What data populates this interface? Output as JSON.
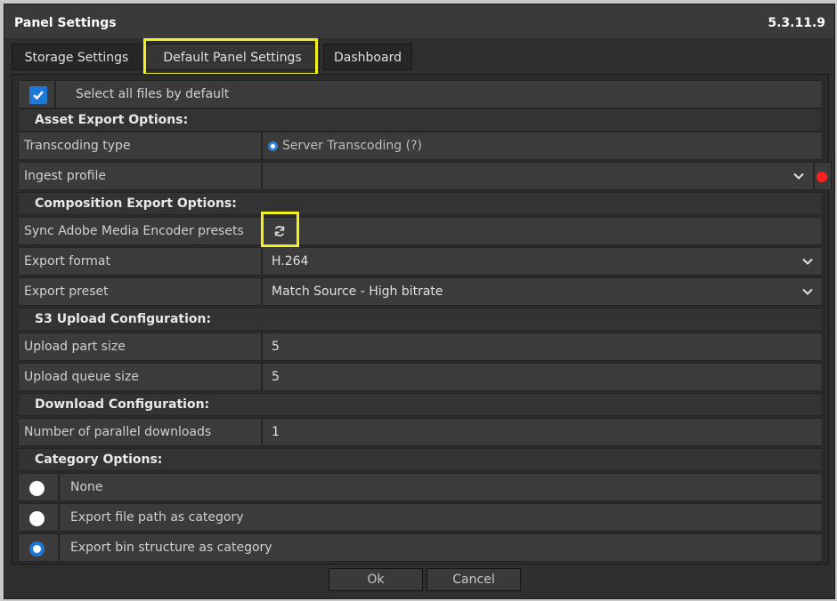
{
  "window": {
    "title": "Panel Settings",
    "version": "5.3.11.9"
  },
  "tabs": [
    {
      "label": "Storage Settings",
      "active": false
    },
    {
      "label": "Default Panel Settings",
      "active": true
    },
    {
      "label": "Dashboard",
      "active": false
    }
  ],
  "select_all": {
    "label": "Select all files by default",
    "checked": true
  },
  "sections": {
    "asset_export": "Asset Export Options:",
    "composition_export": "Composition Export Options:",
    "s3_upload": "S3 Upload Configuration:",
    "download": "Download Configuration:",
    "category": "Category Options:"
  },
  "fields": {
    "transcoding_type": {
      "label": "Transcoding type",
      "value": "Server Transcoding (?)"
    },
    "ingest_profile": {
      "label": "Ingest profile",
      "value": ""
    },
    "sync_presets": {
      "label": "Sync Adobe Media Encoder presets"
    },
    "export_format": {
      "label": "Export format",
      "value": "H.264"
    },
    "export_preset": {
      "label": "Export preset",
      "value": "Match Source - High bitrate"
    },
    "upload_part_size": {
      "label": "Upload part size",
      "value": "5"
    },
    "upload_queue_size": {
      "label": "Upload queue size",
      "value": "5"
    },
    "parallel_downloads": {
      "label": "Number of parallel downloads",
      "value": "1"
    }
  },
  "category_options": [
    {
      "label": "None",
      "selected": false
    },
    {
      "label": "Export file path as category",
      "selected": false
    },
    {
      "label": "Export bin structure as category",
      "selected": true
    }
  ],
  "buttons": {
    "ok": "Ok",
    "cancel": "Cancel"
  },
  "colors": {
    "accent": "#1e78d8",
    "highlight": "#f2f21a",
    "status_red": "#ff2020"
  }
}
